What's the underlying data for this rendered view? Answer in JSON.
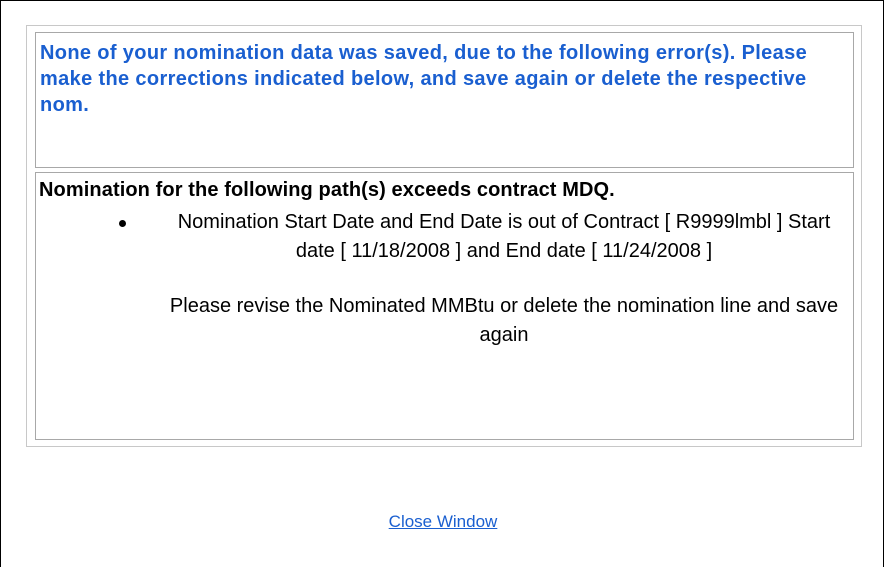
{
  "message": {
    "header": "None of your nomination data was saved, due to the following error(s). Please make the corrections indicated below, and save again or delete the respective nom.",
    "error_title": "Nomination for the following path(s) exceeds contract MDQ.",
    "error_items": [
      "Nomination Start Date and End Date is out of Contract [ R9999lmbl ] Start date [ 11/18/2008 ] and End date [ 11/24/2008 ]"
    ],
    "revise_note": "Please revise the Nominated MMBtu or delete the nomination line and save again"
  },
  "actions": {
    "close_label": "Close Window"
  },
  "colors": {
    "header_text": "#1a5fd0",
    "link": "#1a5fd0",
    "cell_border": "#a8a8a8"
  }
}
